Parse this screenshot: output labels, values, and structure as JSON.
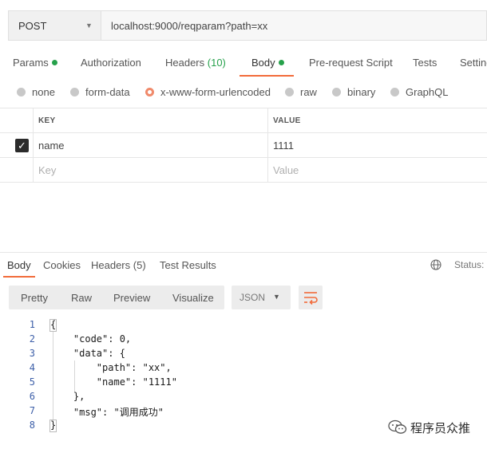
{
  "request": {
    "method": "POST",
    "url": "localhost:9000/reqparam?path=xx"
  },
  "request_tabs": {
    "params": "Params",
    "authorization": "Authorization",
    "headers": "Headers",
    "headers_count": "(10)",
    "body": "Body",
    "prerequest": "Pre-request Script",
    "tests": "Tests",
    "settings": "Setting"
  },
  "body_types": {
    "none": "none",
    "form_data": "form-data",
    "urlencoded": "x-www-form-urlencoded",
    "raw": "raw",
    "binary": "binary",
    "graphql": "GraphQL",
    "selected": "x-www-form-urlencoded"
  },
  "params_table": {
    "headers": [
      "KEY",
      "VALUE"
    ],
    "rows": [
      {
        "key": "name",
        "value": "1111",
        "checked": true
      }
    ],
    "placeholder_key": "Key",
    "placeholder_value": "Value"
  },
  "response_tabs": {
    "body": "Body",
    "cookies": "Cookies",
    "headers": "Headers",
    "headers_count": "(5)",
    "test_results": "Test Results",
    "status": "Status:"
  },
  "view_modes": {
    "pretty": "Pretty",
    "raw": "Raw",
    "preview": "Preview",
    "visualize": "Visualize",
    "format": "JSON"
  },
  "response_code": {
    "line_numbers": [
      "1",
      "2",
      "3",
      "4",
      "5",
      "6",
      "7",
      "8"
    ],
    "lines": [
      "{",
      "    \"code\": 0,",
      "    \"data\": {",
      "        \"path\": \"xx\",",
      "        \"name\": \"1111\"",
      "    },",
      "    \"msg\": \"调用成功\"",
      "}"
    ]
  },
  "watermark": "程序员众推",
  "colors": {
    "accent": "#f26b3a",
    "green_dot": "#26a14b",
    "line_number": "#3d5fa8"
  }
}
